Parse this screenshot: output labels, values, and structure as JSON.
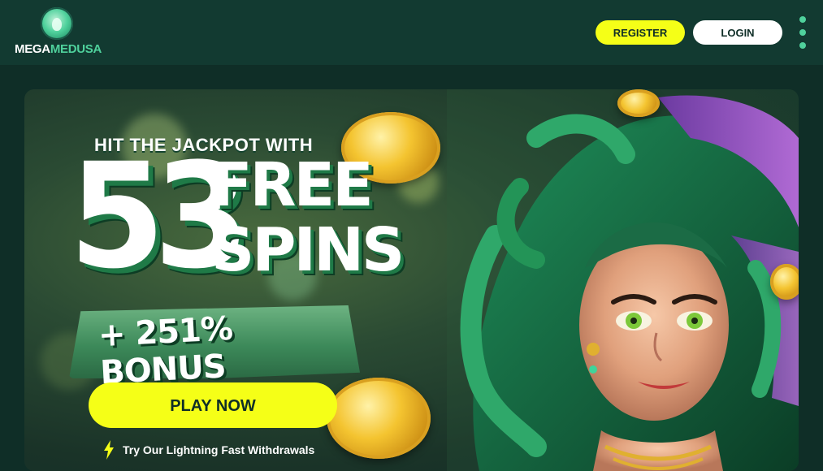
{
  "brand": {
    "logo_part1": "MEGA",
    "logo_part2": "MEDUSA",
    "accent_color": "#4fd19c",
    "cta_color": "#f5ff17",
    "header_bg": "#123a31"
  },
  "header": {
    "register_label": "REGISTER",
    "login_label": "LOGIN",
    "menu_icon": "kebab-menu-icon"
  },
  "promo": {
    "tagline": "HIT THE JACKPOT WITH",
    "spins_count": "53",
    "free_label": "FREE",
    "spins_label": "SPINS",
    "bonus_label": "+ 251% BONUS",
    "cta_label": "PLAY NOW",
    "withdraw_text": "Try Our Lightning Fast Withdrawals",
    "withdraw_icon": "lightning-bolt-icon"
  }
}
